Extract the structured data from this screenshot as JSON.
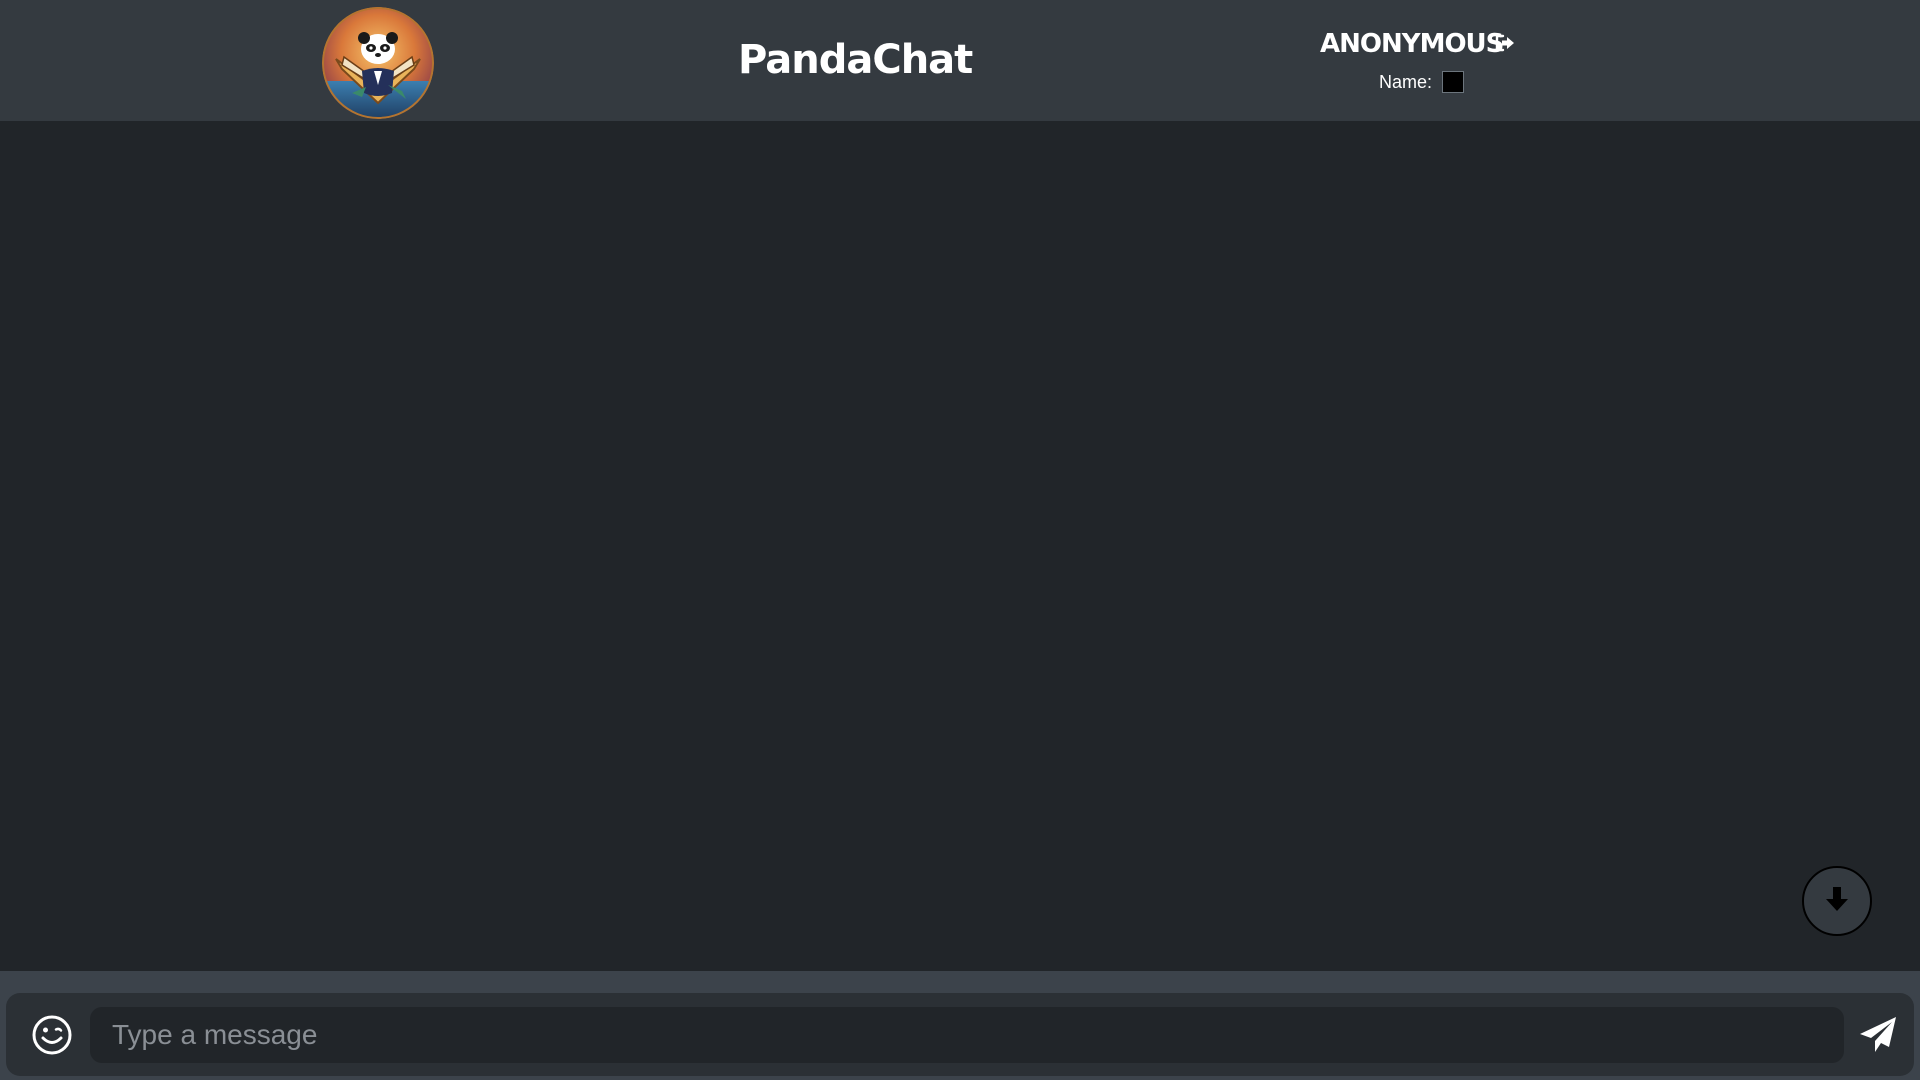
{
  "header": {
    "logo_icon": "panda-logo-icon",
    "title": "PandaChat",
    "user": {
      "username": "ANONYMOUS",
      "logout_icon": "sign-out-icon",
      "name_label": "Name:",
      "name_color": "#000000"
    }
  },
  "chat": {
    "messages": [],
    "scroll_down_icon": "arrow-down-icon"
  },
  "composer": {
    "emoji_icon": "smiley-icon",
    "input_placeholder": "Type a message",
    "input_value": "",
    "send_icon": "paper-plane-icon"
  },
  "colors": {
    "header_bg": "#343a40",
    "page_bg": "#212529",
    "footer_bg": "#3c434b",
    "composer_bg": "#2b3035",
    "text": "#ffffff"
  }
}
